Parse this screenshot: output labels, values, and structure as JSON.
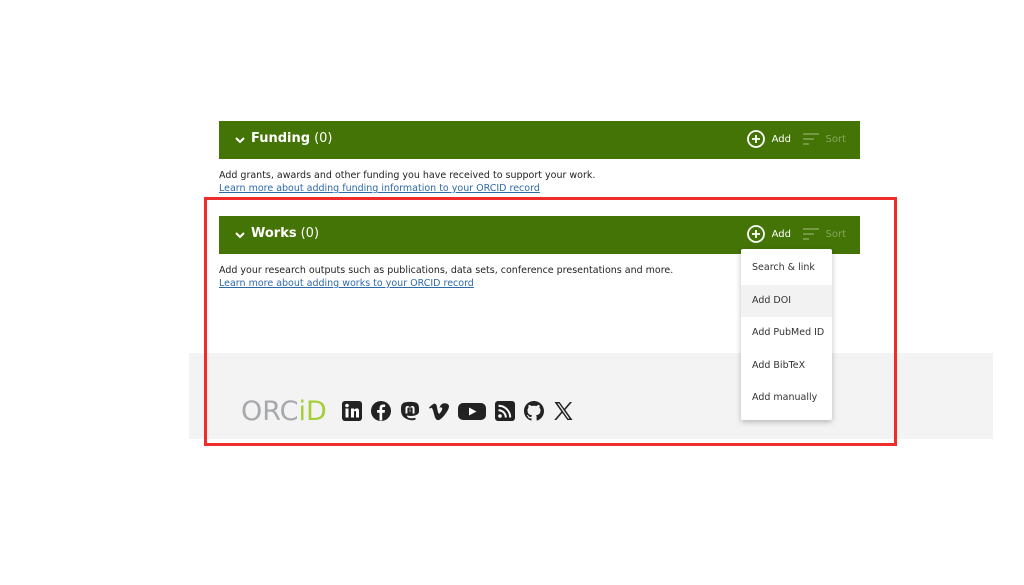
{
  "funding": {
    "title": "Funding",
    "count": "(0)",
    "add_label": "Add",
    "sort_label": "Sort",
    "description": "Add grants, awards and other funding you have received to support your work.",
    "learn_more": "Learn more about adding funding information to your ORCID record"
  },
  "works": {
    "title": "Works",
    "count": "(0)",
    "add_label": "Add",
    "sort_label": "Sort",
    "description": "Add your research outputs such as publications, data sets, conference presentations and more.",
    "learn_more": "Learn more about adding works to your ORCID record"
  },
  "add_menu": {
    "items": [
      "Search & link",
      "Add DOI",
      "Add PubMed ID",
      "Add BibTeX",
      "Add manually"
    ]
  },
  "footer": {
    "logo_orc": "ORC",
    "logo_id": "iD",
    "socials": [
      "linkedin-icon",
      "facebook-icon",
      "mastodon-icon",
      "vimeo-icon",
      "youtube-icon",
      "rss-icon",
      "github-icon",
      "x-icon"
    ]
  },
  "colors": {
    "section_bar": "#447405",
    "link": "#2e6aa8",
    "highlight": "#ee2c2c",
    "logo_gray": "#a6a8ab",
    "logo_green": "#a6ce39"
  }
}
